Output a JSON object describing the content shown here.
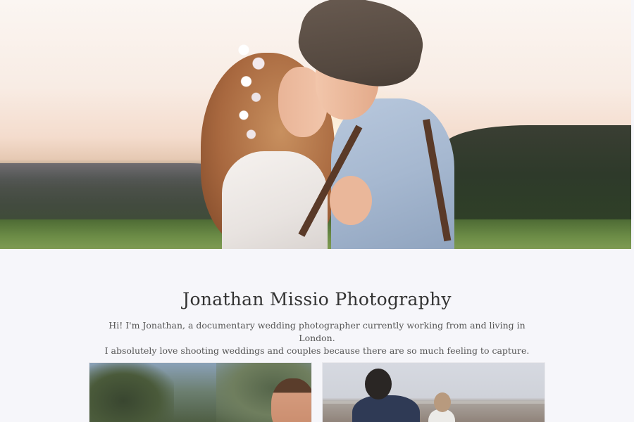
{
  "hero": {
    "image_subject": "couple-at-sunset-photo"
  },
  "intro": {
    "title": "Jonathan Missio Photography",
    "line1": "Hi! I'm Jonathan, a documentary wedding photographer currently working from and living in London.",
    "line2": "I absolutely love shooting weddings and couples because there are so much feeling to capture."
  },
  "gallery": {
    "items": [
      {
        "subject": "groom-portrait-photo"
      },
      {
        "subject": "couple-on-beach-photo"
      }
    ]
  },
  "colors": {
    "background": "#f6f6fa",
    "title": "#333333",
    "body_text": "#555555"
  }
}
